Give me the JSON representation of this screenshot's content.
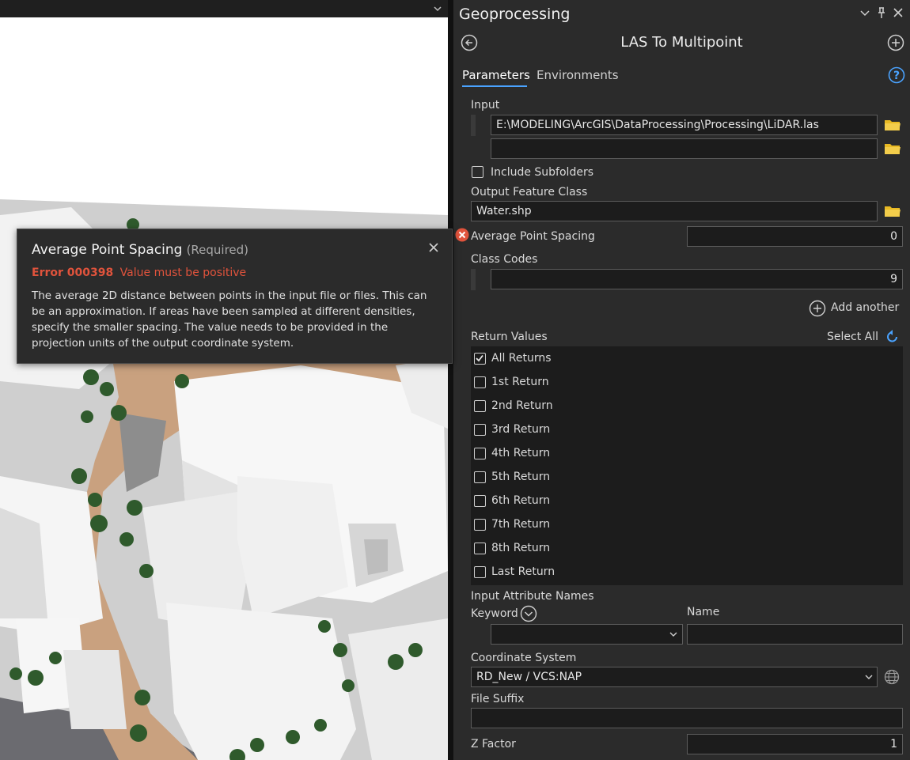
{
  "panel": {
    "title": "Geoprocessing",
    "tool_title": "LAS To Multipoint",
    "tabs": [
      "Parameters",
      "Environments"
    ],
    "active_tab": "Parameters"
  },
  "params": {
    "input_label": "Input",
    "input_value_1": "E:\\MODELING\\ArcGIS\\DataProcessing\\Processing\\LiDAR.las",
    "input_value_2": "",
    "include_subfolders_label": "Include Subfolders",
    "output_label": "Output Feature Class",
    "output_value": "Water.shp",
    "avg_spacing_label": "Average Point Spacing",
    "avg_spacing_value": "0",
    "class_codes_label": "Class Codes",
    "class_codes_value": "9",
    "add_another_label": "Add another",
    "return_values_label": "Return Values",
    "select_all_label": "Select All",
    "return_values": [
      {
        "label": "All Returns",
        "checked": true
      },
      {
        "label": "1st Return",
        "checked": false
      },
      {
        "label": "2nd Return",
        "checked": false
      },
      {
        "label": "3rd Return",
        "checked": false
      },
      {
        "label": "4th Return",
        "checked": false
      },
      {
        "label": "5th Return",
        "checked": false
      },
      {
        "label": "6th Return",
        "checked": false
      },
      {
        "label": "7th Return",
        "checked": false
      },
      {
        "label": "8th Return",
        "checked": false
      },
      {
        "label": "Last Return",
        "checked": false
      }
    ],
    "input_attr_label": "Input Attribute Names",
    "keyword_label": "Keyword",
    "name_label": "Name",
    "keyword_value": "",
    "name_value": "",
    "coord_label": "Coordinate System",
    "coord_value": "RD_New / VCS:NAP",
    "file_suffix_label": "File Suffix",
    "file_suffix_value": "",
    "z_factor_label": "Z Factor",
    "z_factor_value": "1"
  },
  "tooltip": {
    "title": "Average Point Spacing",
    "required": "(Required)",
    "error_code": "Error 000398",
    "error_message": "Value must be positive",
    "body": "The average 2D distance between points in the input file or files. This can be an approximation. If areas have been sampled at different densities, specify the smaller spacing. The value needs to be provided in the projection units of the output coordinate system."
  },
  "colors": {
    "accent": "#4aa3ff",
    "error": "#e0533c",
    "folder": "#e8b923",
    "panel_bg": "#2b2b2b",
    "field_bg": "#1c1c1c"
  }
}
